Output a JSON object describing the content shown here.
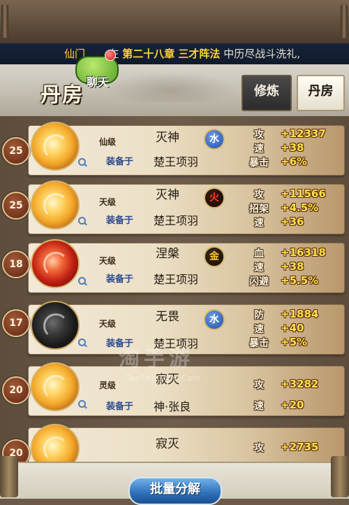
{
  "ticker": {
    "sender": "仙门",
    "text_a": "在",
    "chapter": "第二十八章 三才阵法",
    "text_b": "中历尽战斗洗礼,"
  },
  "header": {
    "title": "丹房",
    "chat_label": "聊天",
    "tabs": [
      {
        "label": "修炼"
      },
      {
        "label": "丹房"
      }
    ]
  },
  "items": [
    {
      "level": "25",
      "rank": "仙级",
      "name": "灭神",
      "element": "水",
      "equip_label": "装备于",
      "hero": "楚王项羽",
      "stats": [
        {
          "name": "攻",
          "value": "+12337"
        },
        {
          "name": "速",
          "value": "+38"
        },
        {
          "name": "暴击",
          "value": "+6%"
        }
      ]
    },
    {
      "level": "25",
      "rank": "天级",
      "name": "灭神",
      "element": "火",
      "equip_label": "装备于",
      "hero": "楚王项羽",
      "stats": [
        {
          "name": "攻",
          "value": "+11566"
        },
        {
          "name": "招架",
          "value": "+4.5%"
        },
        {
          "name": "速",
          "value": "+36"
        }
      ]
    },
    {
      "level": "18",
      "rank": "天级",
      "name": "涅槃",
      "element": "金",
      "equip_label": "装备于",
      "hero": "楚王项羽",
      "stats": [
        {
          "name": "血",
          "value": "+16318"
        },
        {
          "name": "速",
          "value": "+38"
        },
        {
          "name": "闪避",
          "value": "+5.5%"
        }
      ]
    },
    {
      "level": "17",
      "rank": "天级",
      "name": "无畏",
      "element": "水",
      "equip_label": "装备于",
      "hero": "楚王项羽",
      "stats": [
        {
          "name": "防",
          "value": "+1884"
        },
        {
          "name": "速",
          "value": "+40"
        },
        {
          "name": "暴击",
          "value": "+5%"
        }
      ]
    },
    {
      "level": "20",
      "rank": "灵级",
      "name": "寂灭",
      "equip_label": "装备于",
      "hero": "神·张良",
      "stats": [
        {
          "name": "攻",
          "value": "+3282"
        },
        {
          "name": "速",
          "value": "+20"
        }
      ]
    },
    {
      "level": "20",
      "name": "寂灭",
      "stats": [
        {
          "name": "攻",
          "value": "+2735"
        }
      ]
    }
  ],
  "watermark": {
    "main": "淘手游",
    "sub": "TaoShouYou.Com"
  },
  "bottom": {
    "batch_button": "批量分解"
  },
  "colors": {
    "stat_value": "#ffe24a",
    "equip_label": "#2c4a8c",
    "button": "#2d6fb8"
  }
}
